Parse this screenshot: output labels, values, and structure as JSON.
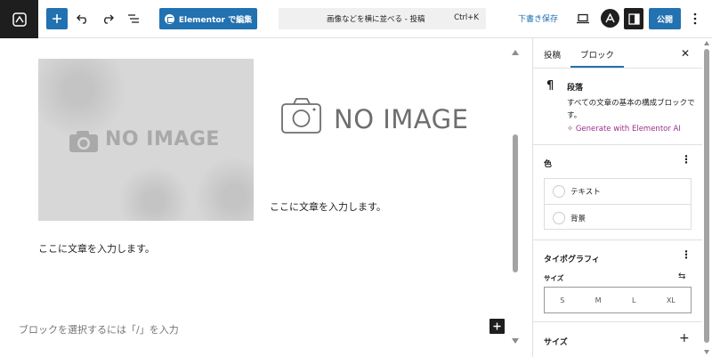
{
  "toolbar": {
    "elementor_label": "Elementor で編集",
    "command_title": "画像などを横に並べる - 投稿",
    "command_shortcut": "Ctrl+K",
    "save_draft": "下書き保存",
    "publish": "公開"
  },
  "canvas": {
    "image_left_text": "NO IMAGE",
    "image_right_text": "NO IMAGE",
    "paragraph_right": "ここに文章を入力します。",
    "paragraph_left": "ここに文章を入力します。",
    "appender_placeholder": "ブロックを選択するには「/」を入力"
  },
  "sidebar": {
    "tabs": [
      {
        "label": "投稿"
      },
      {
        "label": "ブロック"
      }
    ],
    "block_card": {
      "title": "段落",
      "description": "すべての文章の基本の構成ブロックです。",
      "ai_link": "Generate with Elementor AI"
    },
    "color_panel": {
      "title": "色",
      "items": [
        {
          "label": "テキスト"
        },
        {
          "label": "背景"
        }
      ]
    },
    "typography_panel": {
      "title": "タイポグラフィ",
      "size_label": "サイズ",
      "sizes": [
        "S",
        "M",
        "L",
        "XL"
      ]
    },
    "size_panel": {
      "title": "サイズ"
    }
  },
  "colors": {
    "accent": "#2271b1",
    "dark": "#1e1e1e",
    "ai_link": "#9b2f8f"
  }
}
